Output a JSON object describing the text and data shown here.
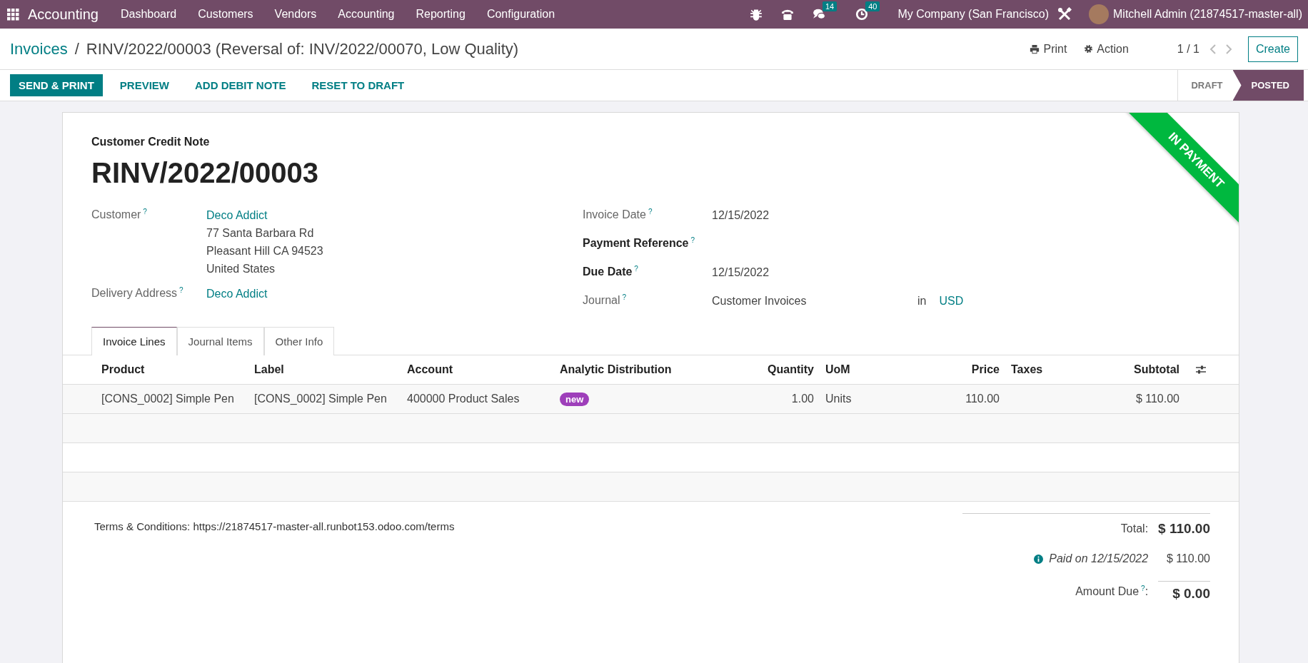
{
  "navbar": {
    "app": "Accounting",
    "menu": [
      "Dashboard",
      "Customers",
      "Vendors",
      "Accounting",
      "Reporting",
      "Configuration"
    ],
    "systray": [
      {
        "kind": "bug"
      },
      {
        "kind": "phone"
      },
      {
        "kind": "chat",
        "count": "14"
      },
      {
        "kind": "activity",
        "count": "40"
      }
    ],
    "company": "My Company (San Francisco)",
    "user": "Mitchell Admin (21874517-master-all)"
  },
  "breadcrumb": {
    "parent": "Invoices",
    "separator": "/",
    "current": "RINV/2022/00003 (Reversal of: INV/2022/00070, Low Quality)"
  },
  "control_panel": {
    "print": "Print",
    "action": "Action",
    "pager": "1 / 1",
    "create": "Create"
  },
  "action_buttons": [
    {
      "label": "SEND & PRINT",
      "primary": true
    },
    {
      "label": "PREVIEW",
      "primary": false
    },
    {
      "label": "ADD DEBIT NOTE",
      "primary": false
    },
    {
      "label": "RESET TO DRAFT",
      "primary": false
    }
  ],
  "status_bar": [
    {
      "label": "DRAFT",
      "selected": false
    },
    {
      "label": "POSTED",
      "selected": true
    }
  ],
  "form": {
    "ribbon": "IN PAYMENT",
    "type": "Customer Credit Note",
    "name": "RINV/2022/00003",
    "left_fields": [
      {
        "label": "Customer",
        "help": "?",
        "link": "Deco Addict",
        "lines": [
          "77 Santa Barbara Rd",
          "Pleasant Hill CA 94523",
          "United States"
        ]
      },
      {
        "label": "Delivery Address",
        "help": "?",
        "link": "Deco Addict"
      }
    ],
    "right_fields": [
      {
        "label": "Invoice Date",
        "help": "?",
        "required": false,
        "value": "12/15/2022"
      },
      {
        "label": "Payment Reference",
        "help": "?",
        "required": true
      },
      {
        "label": "Due Date",
        "help": "?",
        "required": true,
        "value": "12/15/2022"
      },
      {
        "label": "Journal",
        "help": "?",
        "required": false,
        "value": "Customer Invoices",
        "suffix": "in",
        "currency": "USD"
      }
    ],
    "tabs": [
      {
        "label": "Invoice Lines",
        "selected": true
      },
      {
        "label": "Journal Items",
        "selected": false
      },
      {
        "label": "Other Info",
        "selected": false
      }
    ]
  },
  "table": {
    "columns": [
      {
        "label": "Product",
        "kind": "text"
      },
      {
        "label": "Label",
        "kind": "text"
      },
      {
        "label": "Account",
        "kind": "text"
      },
      {
        "label": "Analytic Distribution",
        "kind": "text"
      },
      {
        "label": "Quantity",
        "kind": "number"
      },
      {
        "label": "UoM",
        "kind": "text"
      },
      {
        "label": "Price",
        "kind": "number"
      },
      {
        "label": "Taxes",
        "kind": "text"
      },
      {
        "label": "Subtotal",
        "kind": "number"
      }
    ],
    "rows": [
      {
        "cells": [
          {
            "kind": "text",
            "text": "[CONS_0002] Simple Pen"
          },
          {
            "kind": "text",
            "text": "[CONS_0002] Simple Pen"
          },
          {
            "kind": "text",
            "text": "400000 Product Sales"
          },
          {
            "kind": "tag",
            "text": "new"
          },
          {
            "kind": "text",
            "text": "1.00"
          },
          {
            "kind": "text",
            "text": "Units"
          },
          {
            "kind": "text",
            "text": "110.00"
          },
          {
            "kind": "blank"
          },
          {
            "kind": "text",
            "text": "$ 110.00"
          }
        ]
      }
    ]
  },
  "footer": {
    "terms": "Terms & Conditions: https://21874517-master-all.runbot153.odoo.com/terms",
    "total": {
      "label": "Total:",
      "value": "$ 110.00"
    },
    "payments": [
      {
        "label": "Paid on 12/15/2022",
        "amount": "$ 110.00"
      }
    ],
    "amount_due": {
      "label": "Amount Due",
      "help": "?",
      "suffix": ":",
      "value": "$ 0.00"
    }
  }
}
